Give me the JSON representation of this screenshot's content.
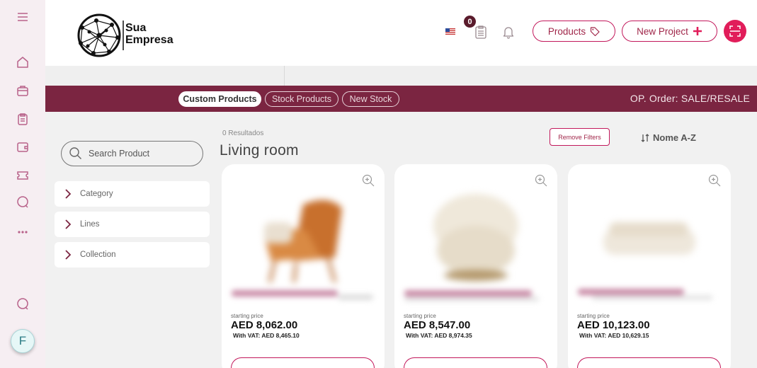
{
  "header": {
    "logo_text_line1": "Sua",
    "logo_text_line2": "Empresa",
    "cart_count": "0",
    "products_label": "Products",
    "new_project_label": "New Project"
  },
  "tabs": [
    {
      "label": "Custom Products",
      "active": true
    },
    {
      "label": "Stock Products",
      "active": false
    },
    {
      "label": "New Stock",
      "active": false
    }
  ],
  "op_order": "OP. Order: SALE/RESALE",
  "filters": {
    "search_placeholder": "Search Product",
    "items": [
      "Category",
      "Lines",
      "Collection"
    ]
  },
  "main": {
    "results": "0 Resultados",
    "section_title": "Living room",
    "remove_filters": "Remove Filters",
    "sort_label": "Nome A-Z"
  },
  "products": [
    {
      "starting": "starting price",
      "price": "AED 8,062.00",
      "vat": "With VAT: AED 8,465.10"
    },
    {
      "starting": "starting price",
      "price": "AED 8,547.00",
      "vat": "With VAT: AED 8,974.35"
    },
    {
      "starting": "starting price",
      "price": "AED 10,123.00",
      "vat": "With VAT: AED 10,629.15"
    }
  ],
  "user": {
    "initial": "F"
  },
  "colors": {
    "brand": "#7b2541",
    "accent": "#e11d5a",
    "outline": "#c2185b"
  }
}
